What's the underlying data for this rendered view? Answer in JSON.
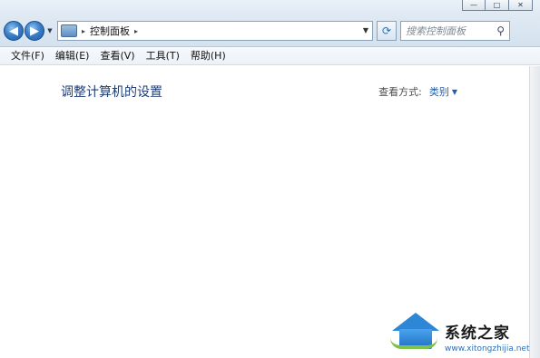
{
  "window": {
    "caption_buttons": [
      "—",
      "□",
      "✕"
    ]
  },
  "nav": {
    "back_glyph": "◀",
    "forward_glyph": "▶",
    "dropdown_glyph": "▼",
    "breadcrumb_sep_glyph": "▸",
    "breadcrumb": [
      "控制面板"
    ],
    "address_dropdown_glyph": "▼",
    "refresh_glyph": "⟳",
    "search_placeholder": "搜索控制面板",
    "search_glyph": "⚲"
  },
  "menu": {
    "items": [
      "文件(F)",
      "编辑(E)",
      "查看(V)",
      "工具(T)",
      "帮助(H)"
    ]
  },
  "content": {
    "title": "调整计算机的设置",
    "view_label": "查看方式:",
    "view_value": "类别",
    "view_dropdown_glyph": "▼"
  },
  "watermark": {
    "title": "系统之家",
    "url": "www.xitongzhijia.net"
  }
}
